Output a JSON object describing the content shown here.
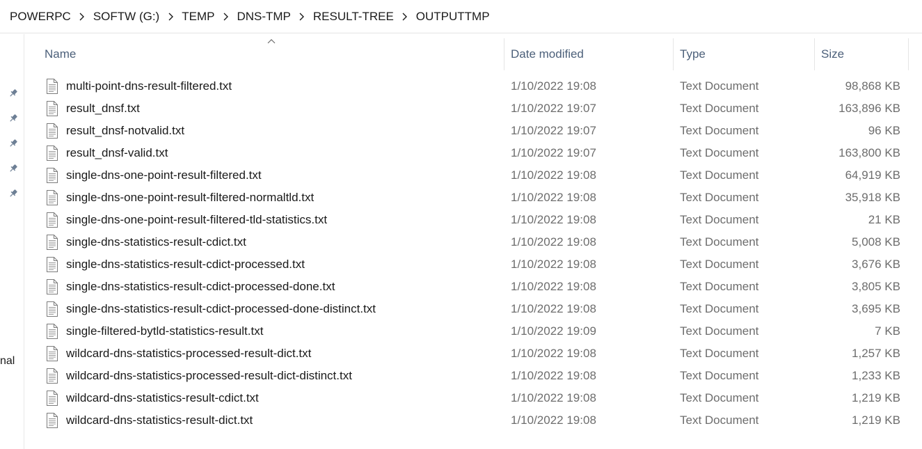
{
  "breadcrumb": [
    "POWERPC",
    "SOFTW (G:)",
    "TEMP",
    "DNS-TMP",
    "RESULT-TREE",
    "OUTPUTTMP"
  ],
  "navpane": {
    "pin_icons": [
      "pin-icon",
      "pin-icon",
      "pin-icon",
      "pin-icon",
      "pin-icon"
    ],
    "partial_label": "nal"
  },
  "columns": {
    "name": "Name",
    "date": "Date modified",
    "type": "Type",
    "size": "Size",
    "sort": "ascending"
  },
  "colors": {
    "header_text": "#4c607a",
    "meta_text": "#6d6d6d",
    "name_text": "#1a1a1a"
  },
  "files": [
    {
      "name": "multi-point-dns-result-filtered.txt",
      "date": "1/10/2022 19:08",
      "type": "Text Document",
      "size": "98,868 KB",
      "icon": "text-file-icon"
    },
    {
      "name": "result_dnsf.txt",
      "date": "1/10/2022 19:07",
      "type": "Text Document",
      "size": "163,896 KB",
      "icon": "text-file-icon"
    },
    {
      "name": "result_dnsf-notvalid.txt",
      "date": "1/10/2022 19:07",
      "type": "Text Document",
      "size": "96 KB",
      "icon": "text-file-icon"
    },
    {
      "name": "result_dnsf-valid.txt",
      "date": "1/10/2022 19:07",
      "type": "Text Document",
      "size": "163,800 KB",
      "icon": "text-file-icon"
    },
    {
      "name": "single-dns-one-point-result-filtered.txt",
      "date": "1/10/2022 19:08",
      "type": "Text Document",
      "size": "64,919 KB",
      "icon": "text-file-icon"
    },
    {
      "name": "single-dns-one-point-result-filtered-normaltld.txt",
      "date": "1/10/2022 19:08",
      "type": "Text Document",
      "size": "35,918 KB",
      "icon": "text-file-icon"
    },
    {
      "name": "single-dns-one-point-result-filtered-tld-statistics.txt",
      "date": "1/10/2022 19:08",
      "type": "Text Document",
      "size": "21 KB",
      "icon": "text-file-icon"
    },
    {
      "name": "single-dns-statistics-result-cdict.txt",
      "date": "1/10/2022 19:08",
      "type": "Text Document",
      "size": "5,008 KB",
      "icon": "text-file-icon"
    },
    {
      "name": "single-dns-statistics-result-cdict-processed.txt",
      "date": "1/10/2022 19:08",
      "type": "Text Document",
      "size": "3,676 KB",
      "icon": "text-file-icon"
    },
    {
      "name": "single-dns-statistics-result-cdict-processed-done.txt",
      "date": "1/10/2022 19:08",
      "type": "Text Document",
      "size": "3,805 KB",
      "icon": "text-file-icon"
    },
    {
      "name": "single-dns-statistics-result-cdict-processed-done-distinct.txt",
      "date": "1/10/2022 19:08",
      "type": "Text Document",
      "size": "3,695 KB",
      "icon": "text-file-icon"
    },
    {
      "name": "single-filtered-bytld-statistics-result.txt",
      "date": "1/10/2022 19:09",
      "type": "Text Document",
      "size": "7 KB",
      "icon": "text-file-icon"
    },
    {
      "name": "wildcard-dns-statistics-processed-result-dict.txt",
      "date": "1/10/2022 19:08",
      "type": "Text Document",
      "size": "1,257 KB",
      "icon": "text-file-icon"
    },
    {
      "name": "wildcard-dns-statistics-processed-result-dict-distinct.txt",
      "date": "1/10/2022 19:08",
      "type": "Text Document",
      "size": "1,233 KB",
      "icon": "text-file-icon"
    },
    {
      "name": "wildcard-dns-statistics-result-cdict.txt",
      "date": "1/10/2022 19:08",
      "type": "Text Document",
      "size": "1,219 KB",
      "icon": "text-file-icon"
    },
    {
      "name": "wildcard-dns-statistics-result-dict.txt",
      "date": "1/10/2022 19:08",
      "type": "Text Document",
      "size": "1,219 KB",
      "icon": "text-file-icon"
    }
  ]
}
